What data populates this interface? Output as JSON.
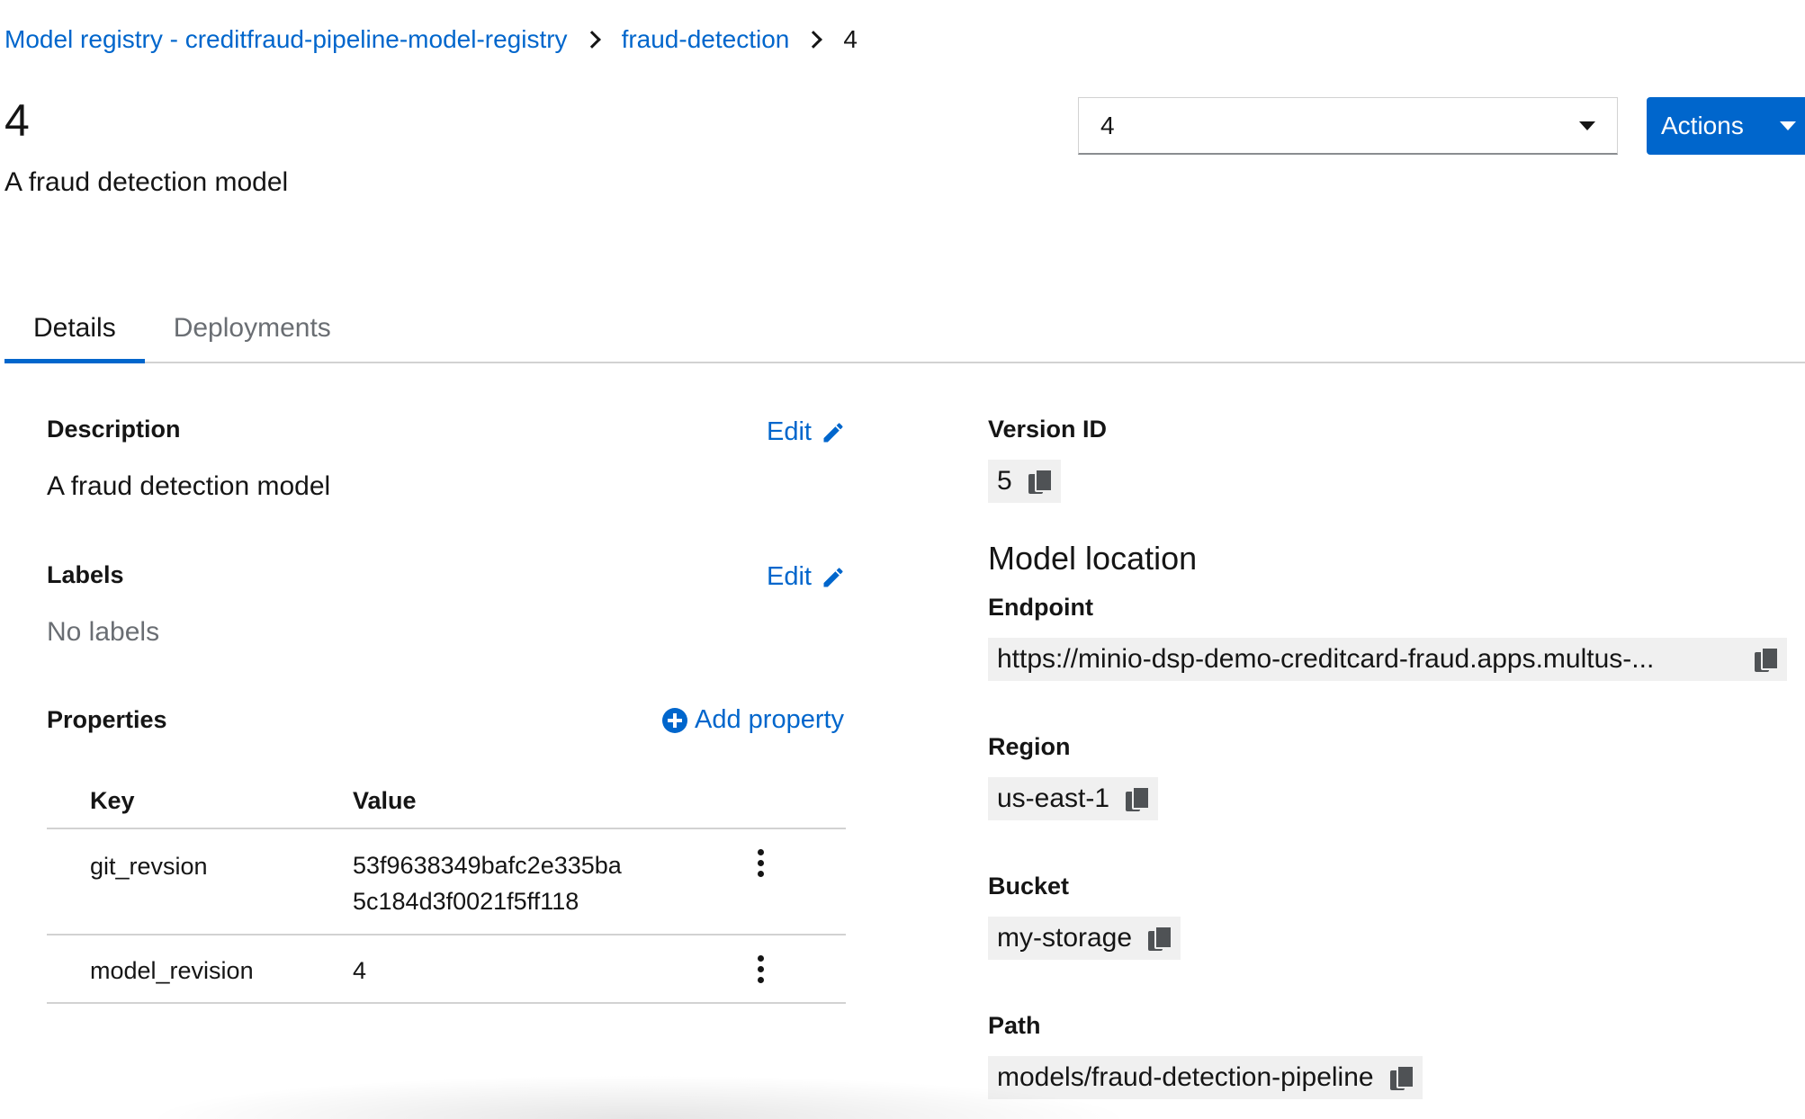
{
  "breadcrumb": {
    "registry": "Model registry - creditfraud-pipeline-model-registry",
    "model": "fraud-detection",
    "current": "4"
  },
  "header": {
    "title": "4",
    "subtitle": "A fraud detection model",
    "version_select_value": "4",
    "actions_label": "Actions"
  },
  "tabs": [
    {
      "label": "Details",
      "active": true
    },
    {
      "label": "Deployments",
      "active": false
    }
  ],
  "details": {
    "description_label": "Description",
    "description_value": "A fraud detection model",
    "labels_label": "Labels",
    "labels_value": "No labels",
    "edit_label": "Edit",
    "properties_label": "Properties",
    "add_property_label": "Add property",
    "table": {
      "headers": [
        "Key",
        "Value"
      ],
      "rows": [
        {
          "key": "git_revsion",
          "value_line1": "53f9638349bafc2e335ba",
          "value_line2": "5c184d3f0021f5ff118"
        },
        {
          "key": "model_revision",
          "value_line1": "4",
          "value_line2": ""
        }
      ]
    }
  },
  "info": {
    "version_id_label": "Version ID",
    "version_id_value": "5",
    "model_location_title": "Model location",
    "endpoint_label": "Endpoint",
    "endpoint_value": "https://minio-dsp-demo-creditcard-fraud.apps.multus-...",
    "region_label": "Region",
    "region_value": "us-east-1",
    "bucket_label": "Bucket",
    "bucket_value": "my-storage",
    "path_label": "Path",
    "path_value": "models/fraud-detection-pipeline"
  },
  "colors": {
    "accent": "#0066cc",
    "text": "#151515",
    "muted": "#6a6e73",
    "copy_bg": "#f0f0f0"
  }
}
